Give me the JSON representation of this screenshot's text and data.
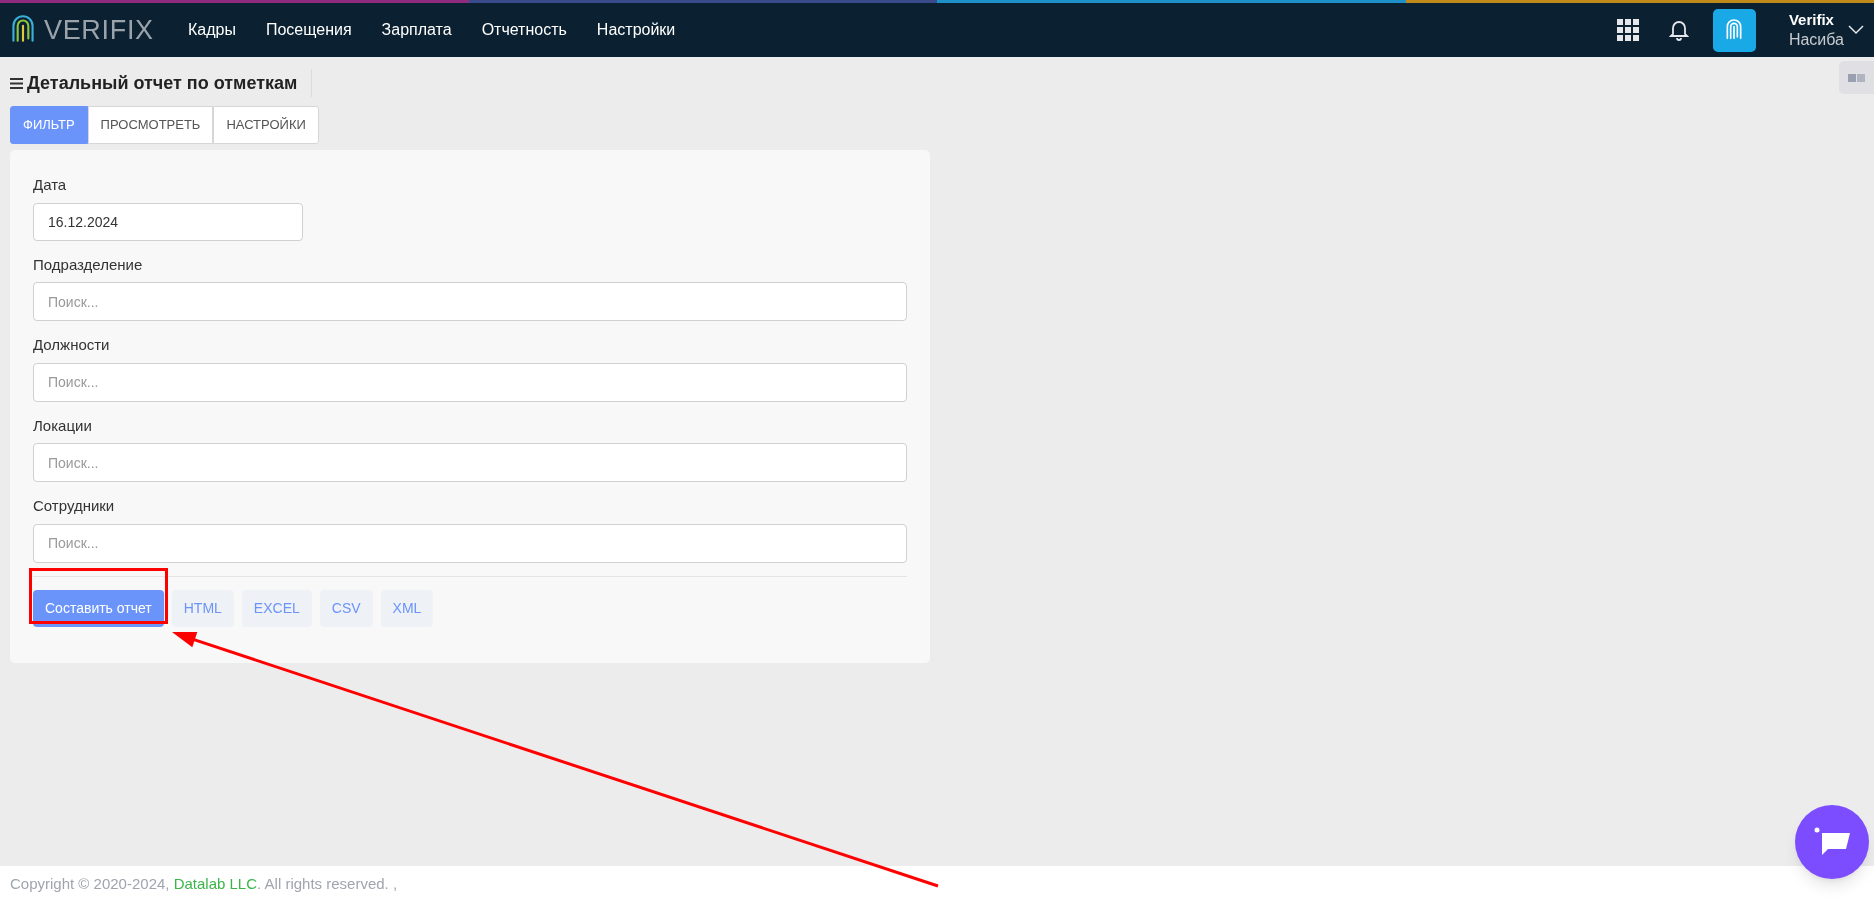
{
  "header": {
    "logo": "VERIFIX",
    "nav": [
      {
        "label": "Кадры"
      },
      {
        "label": "Посещения"
      },
      {
        "label": "Зарплата"
      },
      {
        "label": "Отчетность"
      },
      {
        "label": "Настройки"
      }
    ],
    "user": {
      "company": "Verifix",
      "name": "Насиба"
    }
  },
  "page": {
    "title": "Детальный отчет по отметкам",
    "tabs": [
      {
        "label": "ФИЛЬТР",
        "selected": true
      },
      {
        "label": "ПРОСМОТРЕТЬ",
        "selected": false
      },
      {
        "label": "НАСТРОЙКИ",
        "selected": false
      }
    ]
  },
  "form": {
    "fields": [
      {
        "label": "Дата",
        "value": "16.12.2024",
        "kind": "date"
      },
      {
        "label": "Подразделение",
        "placeholder": "Поиск...",
        "kind": "search"
      },
      {
        "label": "Должности",
        "placeholder": "Поиск...",
        "kind": "search"
      },
      {
        "label": "Локации",
        "placeholder": "Поиск...",
        "kind": "search"
      },
      {
        "label": "Сотрудники",
        "placeholder": "Поиск...",
        "kind": "search"
      }
    ],
    "buttons": [
      {
        "label": "Составить отчет",
        "kind": "primary"
      },
      {
        "label": "HTML",
        "kind": "format"
      },
      {
        "label": "EXCEL",
        "kind": "format"
      },
      {
        "label": "CSV",
        "kind": "format"
      },
      {
        "label": "XML",
        "kind": "format"
      }
    ]
  },
  "footer": {
    "text_before": "Copyright © 2020-2024, ",
    "link": "Datalab LLC",
    "text_after": ". All rights reserved. ,"
  }
}
